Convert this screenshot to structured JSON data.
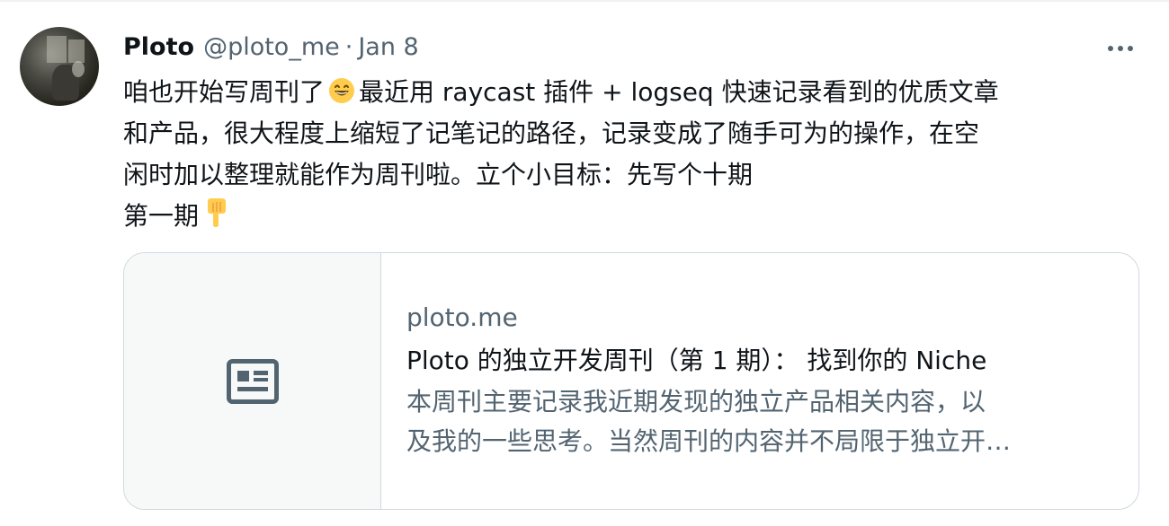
{
  "tweet": {
    "author": {
      "display_name": "Ploto",
      "handle": "@ploto_me",
      "separator": "·",
      "date": "Jan 8"
    },
    "more_icon": "more-horizontal-icon",
    "text": {
      "line1_a": "咱也开始写周刊了",
      "line1_emoji": "grinning-face-emoji",
      "line1_b": "最近用 raycast 插件 + logseq 快速记录看到的优质文章",
      "line2": "和产品，很大程度上缩短了记笔记的路径，记录变成了随手可为的操作，在空",
      "line3": "闲时加以整理就能作为周刊啦。立个小目标：先写个十期",
      "line4": "第一期",
      "line4_emoji": "backhand-pointing-down-emoji"
    },
    "card": {
      "media_icon": "article-icon",
      "domain": "ploto.me",
      "title": "Ploto 的独立开发周刊（第 1 期）：  找到你的 Niche",
      "description_line1": "本周刊主要记录我近期发现的独立产品相关内容，以",
      "description_line2": "及我的一些思考。当然周刊的内容并不局限于独立开…"
    }
  },
  "colors": {
    "text_primary": "#0f1419",
    "text_secondary": "#536471",
    "border": "#cfd9de",
    "card_media_bg": "#f7f9f9"
  }
}
